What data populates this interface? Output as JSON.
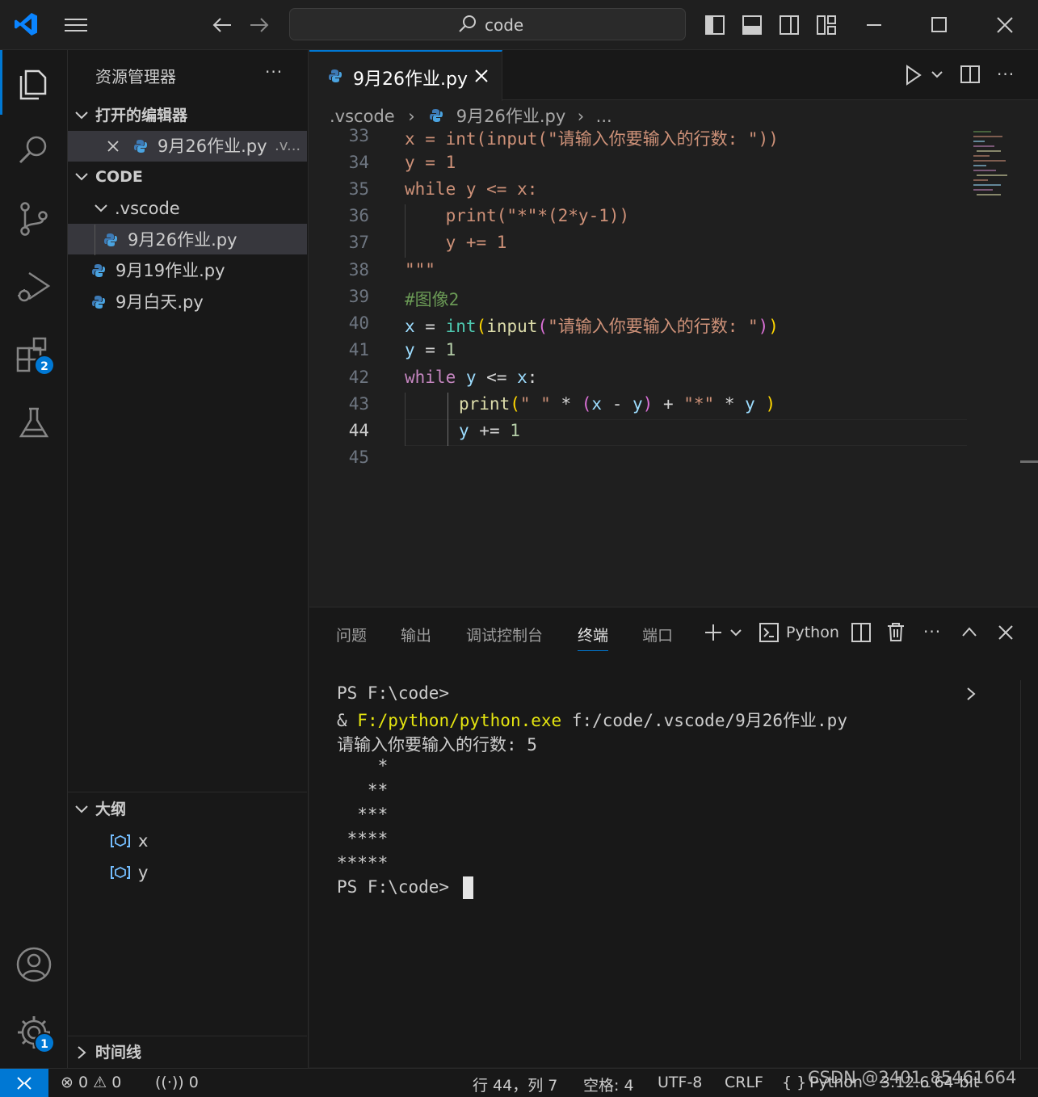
{
  "titlebar": {
    "search_text": "code"
  },
  "activitybar": {
    "extensions_badge": "2",
    "settings_badge": "1"
  },
  "sidebar": {
    "title": "资源管理器",
    "more": "···",
    "open_editors_title": "打开的编辑器",
    "open_editor_item": "9月26作业.py",
    "open_editor_path": ".v...",
    "code_section_title": "CODE",
    "folder_vscode": ".vscode",
    "files": [
      "9月26作业.py",
      "9月19作业.py",
      "9月白天.py"
    ],
    "outline_title": "大纲",
    "outline_items": [
      "x",
      "y"
    ],
    "timeline_title": "时间线"
  },
  "editor": {
    "tab_label": "9月26作业.py",
    "breadcrumb": [
      ".vscode",
      "9月26作业.py",
      "..."
    ],
    "lines": [
      {
        "num": "33"
      },
      {
        "num": "34"
      },
      {
        "num": "35"
      },
      {
        "num": "36"
      },
      {
        "num": "37"
      },
      {
        "num": "38"
      },
      {
        "num": "39"
      },
      {
        "num": "40"
      },
      {
        "num": "41"
      },
      {
        "num": "42"
      },
      {
        "num": "43"
      },
      {
        "num": "44"
      },
      {
        "num": "45"
      }
    ],
    "code": {
      "l33": "x = int(input(\"请输入你要输入的行数: \"))",
      "l34": "y = 1",
      "l35": "while y <= x:",
      "l36": "    print(\"*\"*(2*y-1))",
      "l37": "    y += 1",
      "l38": "\"\"\"",
      "l39": "#图像2",
      "l40_x": "x",
      "l40_int": "int",
      "l40_input": "input",
      "l40_str": "\"请输入你要输入的行数: \"",
      "l41_y": "y",
      "l41_num": "1",
      "l42_kw": "while",
      "l42_y": "y",
      "l42_x": "x",
      "l43_print": "print",
      "l43_s1": "\" \"",
      "l43_x": "x",
      "l43_y": "y",
      "l43_s2": "\"*\"",
      "l43_y2": "y",
      "l44_y": "y",
      "l44_num": "1"
    }
  },
  "panel": {
    "tabs": [
      "问题",
      "输出",
      "调试控制台",
      "终端",
      "端口"
    ],
    "active_tab": "终端",
    "terminal_name": "Python",
    "terminal_lines": {
      "prompt1": "PS F:\\code>",
      "cmd_amp": "& ",
      "cmd_exe": "F:/python/python.exe",
      "cmd_arg": " f:/code/.vscode/9月26作业.py",
      "input_prompt": "请输入你要输入的行数: 5",
      "out1": "    *",
      "out2": "   **",
      "out3": "  ***",
      "out4": " ****",
      "out5": "*****",
      "prompt2": "PS F:\\code>"
    }
  },
  "statusbar": {
    "errors": "0",
    "warnings": "0",
    "ports": "0",
    "position": "行 44，列 7",
    "spaces": "空格: 4",
    "encoding": "UTF-8",
    "eol": "CRLF",
    "language": "Python",
    "interpreter": "3.12.6 64-bit",
    "watermark": "CSDN @2401_85461664"
  }
}
